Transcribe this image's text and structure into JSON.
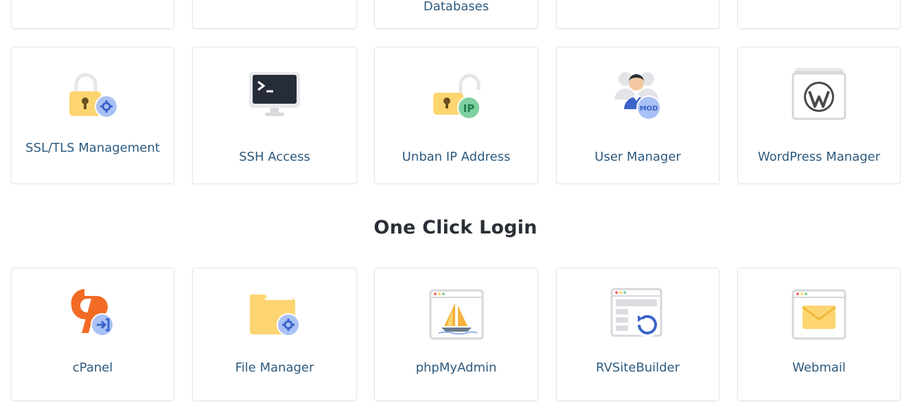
{
  "top_row": {
    "items": [
      {
        "label": ""
      },
      {
        "label": ""
      },
      {
        "label": "Databases"
      },
      {
        "label": ""
      },
      {
        "label": ""
      }
    ]
  },
  "tools": {
    "items": [
      {
        "label": "SSL/TLS Management",
        "icon": "ssl-lock-gear-icon"
      },
      {
        "label": "SSH Access",
        "icon": "terminal-monitor-icon"
      },
      {
        "label": "Unban IP Address",
        "icon": "unlocked-ip-icon"
      },
      {
        "label": "User Manager",
        "icon": "users-mod-icon"
      },
      {
        "label": "WordPress Manager",
        "icon": "wordpress-icon"
      }
    ]
  },
  "one_click_login": {
    "title": "One Click Login",
    "items": [
      {
        "label": "cPanel",
        "icon": "cpanel-login-icon"
      },
      {
        "label": "File Manager",
        "icon": "folder-gear-icon"
      },
      {
        "label": "phpMyAdmin",
        "icon": "phpmyadmin-sailboat-icon"
      },
      {
        "label": "RVSiteBuilder",
        "icon": "sitebuilder-refresh-icon"
      },
      {
        "label": "Webmail",
        "icon": "mail-envelope-icon"
      }
    ]
  },
  "colors": {
    "label": "#2d5a7e",
    "title": "#2a2f36",
    "tile_border": "#e3e6ea",
    "badge_blue": "#a9c1f5",
    "badge_green": "#7fd0a1",
    "folder_yellow": "#fcd571",
    "cpanel_orange": "#f26b25"
  }
}
